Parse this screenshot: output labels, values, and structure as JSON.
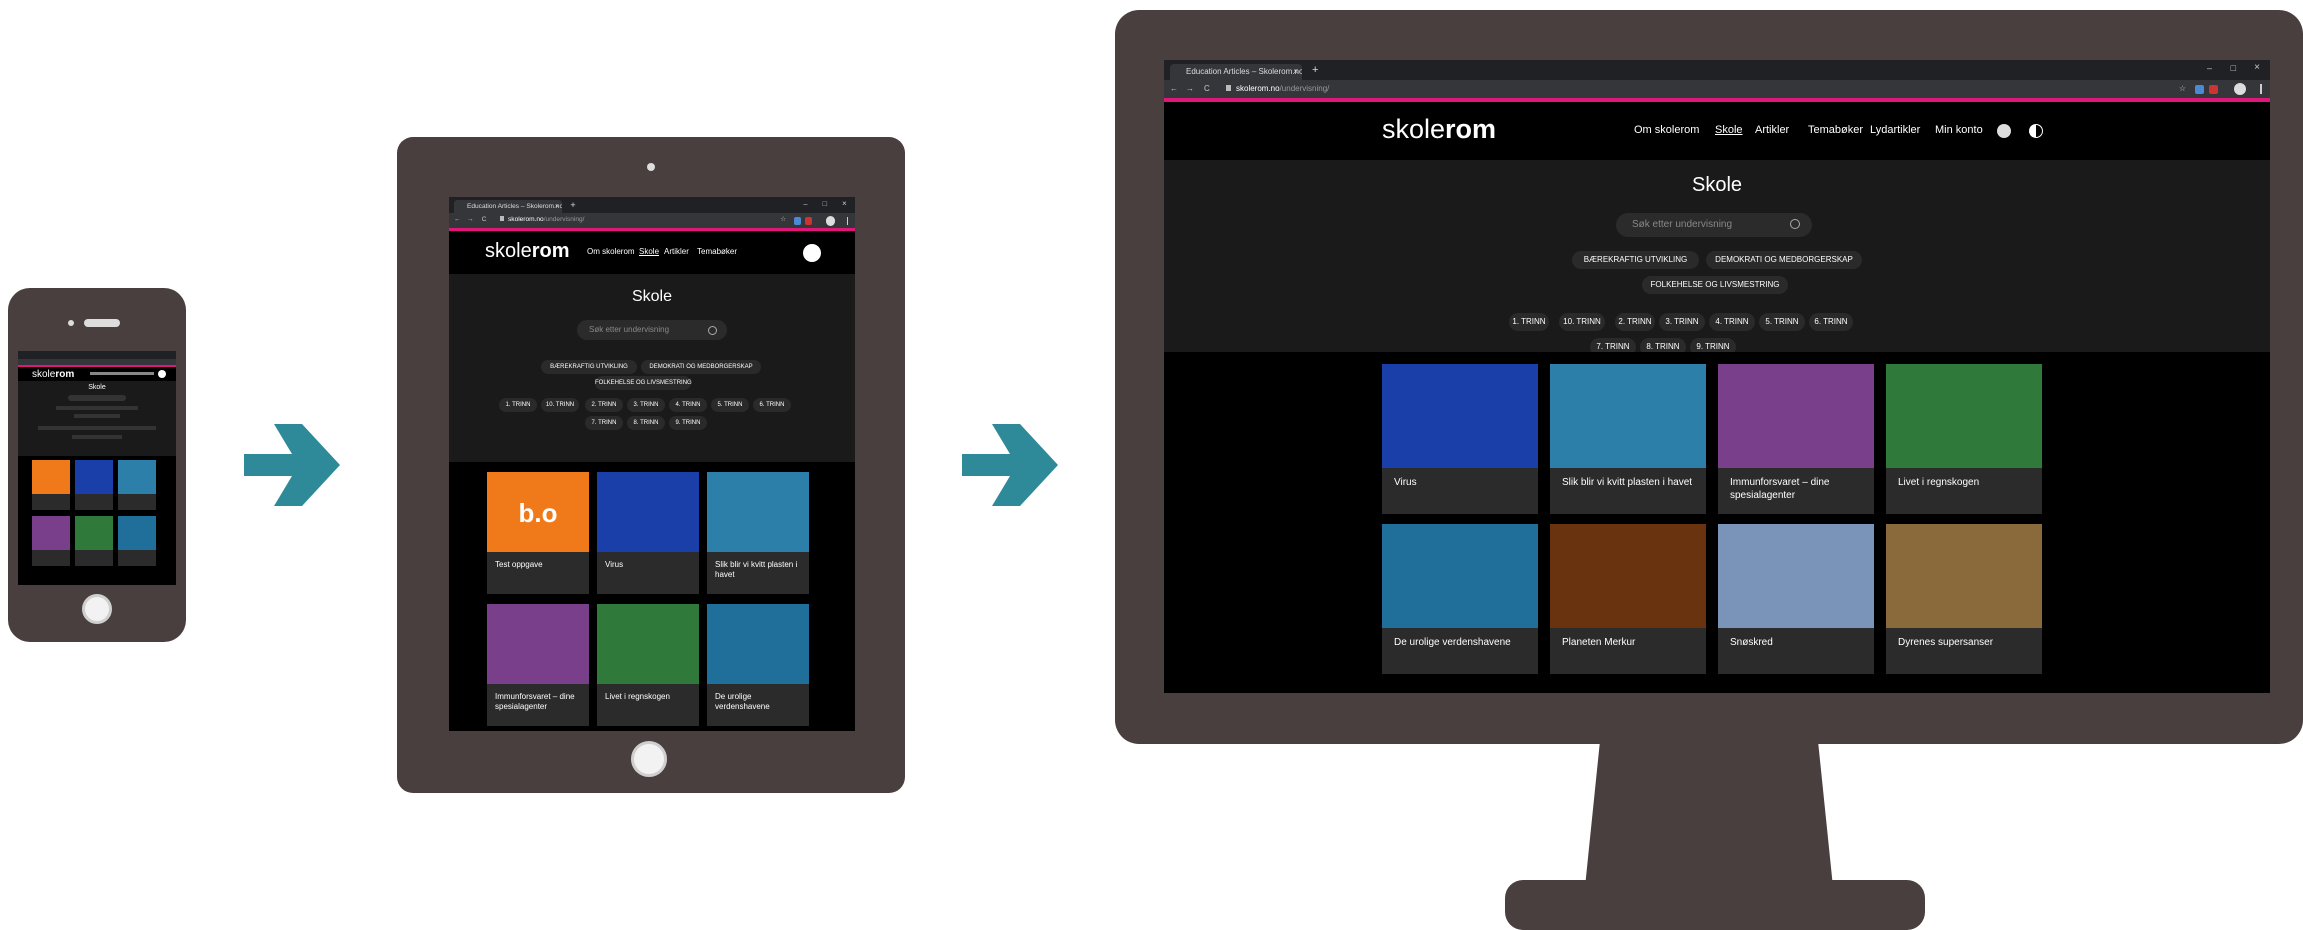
{
  "browser": {
    "tab_title": "Education Articles – Skolerom.no",
    "tab_close": "×",
    "new_tab": "+",
    "url_host": "skolerom.no",
    "url_path": "/undervisning/",
    "win_min": "–",
    "win_max": "□",
    "win_close": "×",
    "back": "←",
    "forward": "→",
    "reload": "C",
    "star": "☆"
  },
  "site": {
    "logo_light": "skole",
    "logo_bold": "rom",
    "nav": [
      "Om skolerom",
      "Skole",
      "Artikler",
      "Temabøker",
      "Lydartikler",
      "Min konto"
    ],
    "title": "Skole",
    "search_placeholder": "Søk etter undervisning",
    "topics": [
      "BÆREKRAFTIG UTVIKLING",
      "DEMOKRATI OG MEDBORGERSKAP",
      "FOLKEHELSE OG LIVSMESTRING"
    ],
    "grades": [
      "1. TRINN",
      "10. TRINN",
      "2. TRINN",
      "3. TRINN",
      "4. TRINN",
      "5. TRINN",
      "6. TRINN",
      "7. TRINN",
      "8. TRINN",
      "9. TRINN"
    ]
  },
  "cards": [
    {
      "title": "Test oppgave",
      "logo": "b.o",
      "color": "#f07a1a"
    },
    {
      "title": "Virus",
      "color": "#1b3fa8"
    },
    {
      "title": "Slik blir vi kvitt plasten i havet",
      "color": "#2b7fa8"
    },
    {
      "title": "Immunforsvaret – dine spesialagenter",
      "color": "#7a3f8a"
    },
    {
      "title": "Livet i regnskogen",
      "color": "#2f7a3a"
    },
    {
      "title": "De urolige verdenshavene",
      "color": "#1f6f9a"
    },
    {
      "title": "Planeten Merkur",
      "color": "#6a3310"
    },
    {
      "title": "Snøskred",
      "color": "#7a93b8"
    },
    {
      "title": "Dyrenes supersanser",
      "color": "#8a6a3a"
    }
  ],
  "colors": {
    "device": "#4a3f3f",
    "arrow": "#2e8a99",
    "accent": "#e0177b"
  }
}
